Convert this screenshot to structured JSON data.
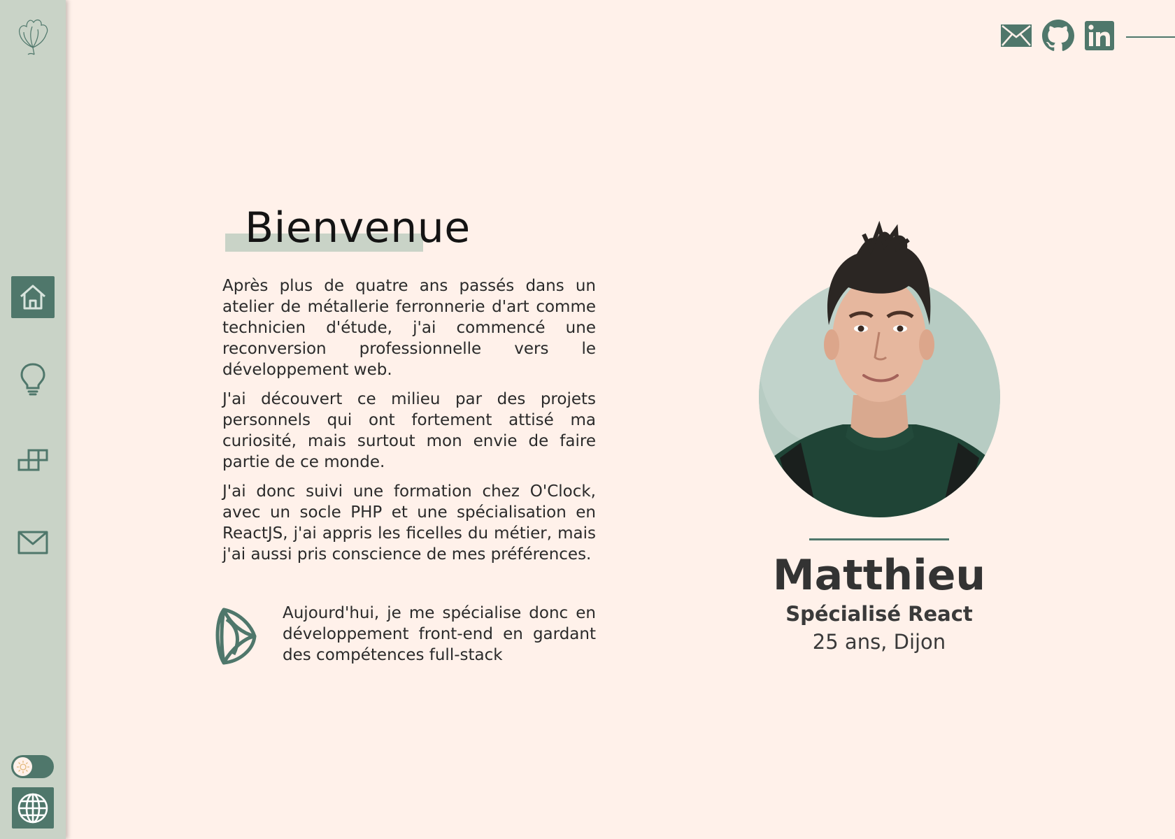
{
  "colors": {
    "background": "#fff1ea",
    "sidebar": "#c9d3c7",
    "accent": "#4f776b",
    "text": "#1d1d1d"
  },
  "sidebar": {
    "logo_icon": "flower-outline-icon",
    "items": [
      {
        "id": "home",
        "icon": "home-icon",
        "active": true
      },
      {
        "id": "skills",
        "icon": "lightbulb-icon",
        "active": false
      },
      {
        "id": "projects",
        "icon": "blocks-icon",
        "active": false
      },
      {
        "id": "contact",
        "icon": "mail-icon",
        "active": false
      }
    ],
    "theme_toggle": {
      "icon": "sun-icon",
      "state": "light"
    },
    "language_icon": "globe-icon"
  },
  "socials": [
    {
      "id": "email",
      "icon": "mail-icon"
    },
    {
      "id": "github",
      "icon": "github-icon"
    },
    {
      "id": "linkedin",
      "icon": "linkedin-icon"
    }
  ],
  "welcome": {
    "title": "Bienvenue",
    "paragraphs": [
      "Après plus de quatre ans passés dans un atelier de métallerie ferronnerie d'art comme technicien d'étude, j'ai commencé une reconversion professionnelle vers le développement web.",
      "J'ai découvert ce milieu par des projets personnels qui ont fortement attisé ma curiosité, mais surtout mon envie de faire partie de ce monde.",
      "J'ai donc suivi une formation chez O'Clock, avec un socle PHP et une spécialisation en ReactJS, j'ai appris les ficelles du métier, mais j'ai aussi pris conscience de mes préférences."
    ],
    "closing": "Aujourd'hui, je me spécialise donc en développement front-end en gardant des compétences full-stack",
    "closing_icon": "lotus-icon"
  },
  "profile": {
    "name": "Matthieu",
    "role": "Spécialisé React",
    "age_location": "25 ans, Dijon"
  }
}
